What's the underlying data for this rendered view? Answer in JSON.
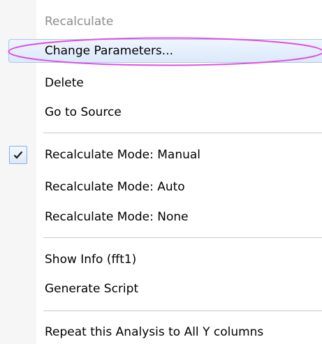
{
  "menu": {
    "items": [
      {
        "label": "Recalculate",
        "enabled": false
      },
      {
        "label": "Change Parameters...",
        "highlighted": true
      },
      {
        "label": "Delete"
      },
      {
        "label": "Go to Source"
      },
      {
        "label": "Recalculate Mode: Manual",
        "checked": true
      },
      {
        "label": "Recalculate Mode: Auto"
      },
      {
        "label": "Recalculate Mode: None"
      },
      {
        "label": "Show Info (fft1)"
      },
      {
        "label": "Generate Script"
      },
      {
        "label": "Repeat this Analysis to All Y columns"
      }
    ],
    "icons": {
      "check": "checkmark-icon"
    }
  },
  "colors": {
    "highlight_fill": "#dbe9fb",
    "highlight_border": "#a8c8ec",
    "annotation_ellipse": "#e14ee3",
    "disabled_text": "#8d8d8d"
  }
}
